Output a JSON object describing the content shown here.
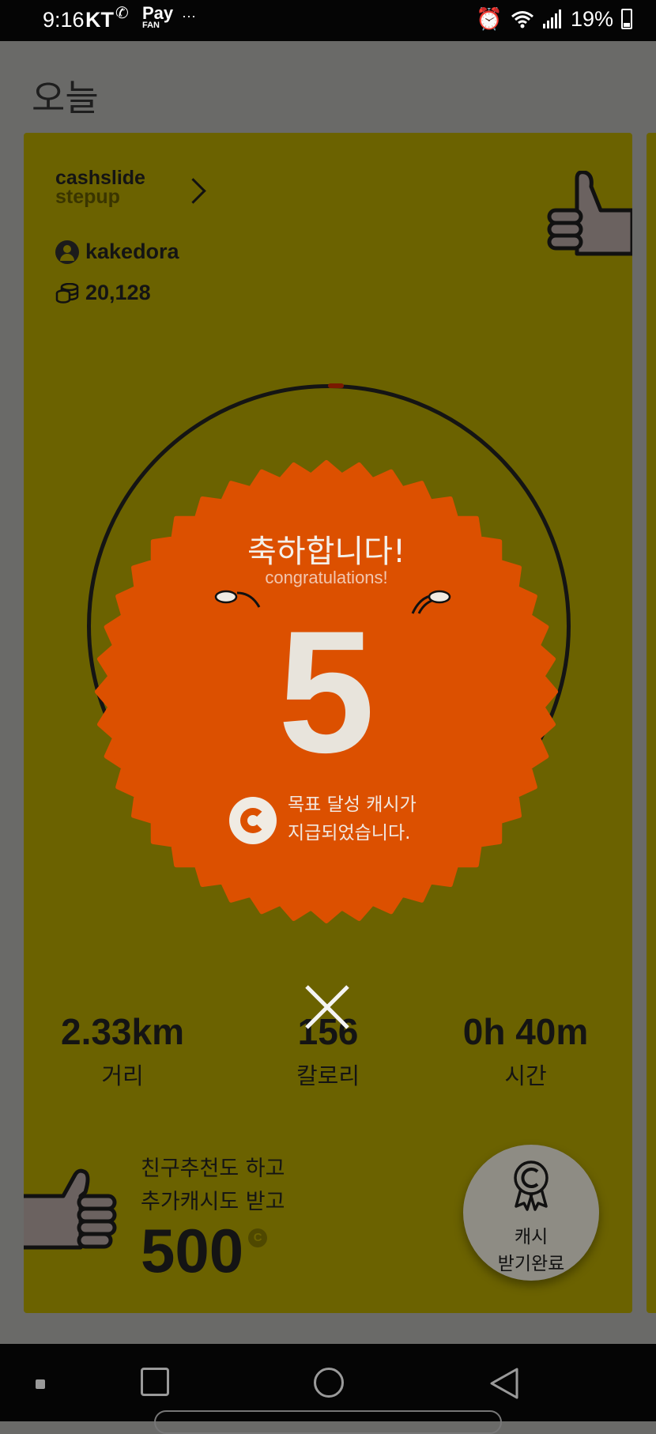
{
  "status_bar": {
    "time": "9:16",
    "carrier": "KT",
    "who_icon": "who who",
    "pay": "Pay",
    "pay_sub": "FAN",
    "more": "···",
    "battery": "19%"
  },
  "page_title": "오늘",
  "card": {
    "brand_line1": "cashslide",
    "brand_line2": "stepup",
    "username": "kakedora",
    "coins": "20,128"
  },
  "popup": {
    "title": "축하합니다!",
    "subtitle": "congratulations!",
    "number": "5",
    "message_line1": "목표 달성 캐시가",
    "message_line2": "지급되었습니다."
  },
  "stats": [
    {
      "value": "2.33km",
      "label": "거리"
    },
    {
      "value": "156",
      "label": "칼로리"
    },
    {
      "value": "0h 40m",
      "label": "시간"
    }
  ],
  "promo": {
    "line1": "친구추천도 하고",
    "line2": "추가캐시도 받고",
    "amount": "500",
    "currency_icon": "C"
  },
  "reward_button": {
    "line1": "캐시",
    "line2": "받기완료"
  },
  "colors": {
    "card": "#6b6200",
    "badge": "#dc5000",
    "overlay": "#6a6a68"
  }
}
